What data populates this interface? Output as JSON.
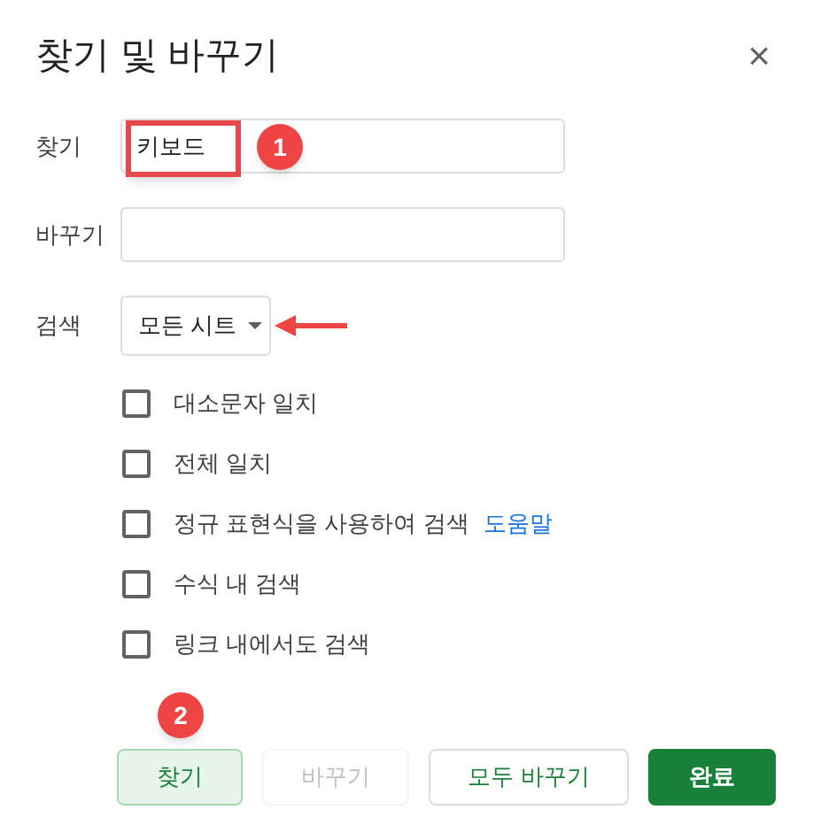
{
  "dialog": {
    "title": "찾기 및 바꾸기",
    "close": "×"
  },
  "fields": [
    {
      "label": "찾기",
      "value": "키보드",
      "highlighted": true,
      "badge": "1"
    },
    {
      "label": "바꾸기"
    }
  ],
  "search_scope": {
    "label": "검색",
    "value": "모든 시트",
    "arrow_annotation": true
  },
  "options": [
    {
      "label": "대소문자 일치",
      "checked": false
    },
    {
      "label": "전체 일치",
      "checked": false
    },
    {
      "label": "정규 표현식을 사용하여 검색",
      "checked": false,
      "link": "도움말"
    },
    {
      "label": "수식 내 검색",
      "checked": false
    },
    {
      "label": "링크 내에서도 검색",
      "checked": false
    }
  ],
  "buttons": [
    {
      "label": "찾기",
      "kind": "active",
      "badge": "2"
    },
    {
      "label": "바꾸기",
      "kind": "disabled"
    },
    {
      "label": "모두 바꾸기",
      "kind": "outline"
    },
    {
      "label": "완료",
      "kind": "primary"
    }
  ]
}
